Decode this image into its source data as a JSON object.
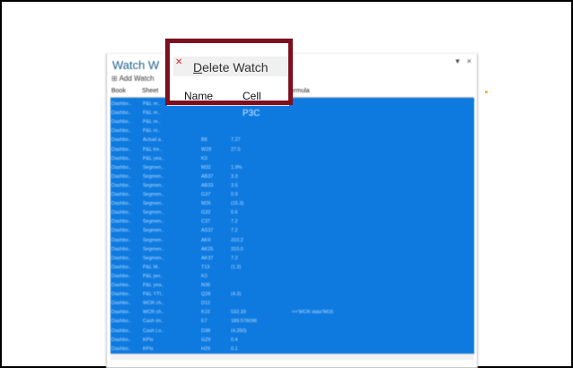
{
  "window": {
    "title": "Watch W",
    "toolbar": {
      "add_label": "Add Watch"
    },
    "controls": {
      "dropdown": "▾",
      "close": "×"
    }
  },
  "columns": [
    "Book",
    "Sheet",
    "Formula"
  ],
  "popup": {
    "menu_item_label_underlined": "D",
    "menu_item_label_rest": "elete Watch",
    "columns": [
      "Name",
      "Cell"
    ]
  },
  "grid": {
    "highlight_cell_text": "P3C",
    "formula_note": "=+'WCR data'!M16",
    "rows": [
      {
        "book": "Dashbo..",
        "sheet": "P&L re..",
        "name": "",
        "cell": "",
        "value": ""
      },
      {
        "book": "Dashbo..",
        "sheet": "P&L re..",
        "name": "",
        "cell": "",
        "value": ""
      },
      {
        "book": "Dashbo..",
        "sheet": "P&L re..",
        "name": "",
        "cell": "",
        "value": ""
      },
      {
        "book": "Dashbo..",
        "sheet": "P&L m..",
        "name": "",
        "cell": "",
        "value": ""
      },
      {
        "book": "Dashbo..",
        "sheet": "Actual a..",
        "name": "",
        "cell": "B8",
        "value": "7.27"
      },
      {
        "book": "Dashbo..",
        "sheet": "P&L tre..",
        "name": "",
        "cell": "W29",
        "value": "27.5"
      },
      {
        "book": "Dashbo..",
        "sheet": "P&L yea..",
        "name": "",
        "cell": "K3",
        "value": ""
      },
      {
        "book": "Dashbo..",
        "sheet": "Segmen..",
        "name": "",
        "cell": "M32",
        "value": "1.9%"
      },
      {
        "book": "Dashbo..",
        "sheet": "Segmen..",
        "name": "",
        "cell": "AB37",
        "value": "3.3"
      },
      {
        "book": "Dashbo..",
        "sheet": "Segmen..",
        "name": "",
        "cell": "AB33",
        "value": "3.5"
      },
      {
        "book": "Dashbo..",
        "sheet": "Segmen..",
        "name": "",
        "cell": "G37",
        "value": "0.9"
      },
      {
        "book": "Dashbo..",
        "sheet": "Segmen..",
        "name": "",
        "cell": "M26",
        "value": "(15.3)"
      },
      {
        "book": "Dashbo..",
        "sheet": "Segmen..",
        "name": "",
        "cell": "G32",
        "value": "0.6"
      },
      {
        "book": "Dashbo..",
        "sheet": "Segmen..",
        "name": "",
        "cell": "C37",
        "value": "7.2"
      },
      {
        "book": "Dashbo..",
        "sheet": "Segmen..",
        "name": "",
        "cell": "AS37",
        "value": "7.2"
      },
      {
        "book": "Dashbo..",
        "sheet": "Segmen..",
        "name": "",
        "cell": "AK9",
        "value": "310.2"
      },
      {
        "book": "Dashbo..",
        "sheet": "Segmen..",
        "name": "",
        "cell": "AK25",
        "value": "310.0"
      },
      {
        "book": "Dashbo..",
        "sheet": "Segmen..",
        "name": "",
        "cell": "AK37",
        "value": "7.2"
      },
      {
        "book": "Dashbo..",
        "sheet": "P&L M..",
        "name": "",
        "cell": "T13",
        "value": "(1.3)"
      },
      {
        "book": "Dashbo..",
        "sheet": "P&L per..",
        "name": "",
        "cell": "K3",
        "value": ""
      },
      {
        "book": "Dashbo..",
        "sheet": "P&L yea..",
        "name": "",
        "cell": "N36",
        "value": ""
      },
      {
        "book": "Dashbo..",
        "sheet": "P&L YTI..",
        "name": "",
        "cell": "Q28",
        "value": "(4.3)"
      },
      {
        "book": "Dashbo..",
        "sheet": "WCR ch..",
        "name": "",
        "cell": "D12",
        "value": ""
      },
      {
        "book": "Dashbo..",
        "sheet": "WCR ch..",
        "name": "",
        "cell": "K15",
        "value": "532.33"
      },
      {
        "book": "Dashbo..",
        "sheet": "Cash im..",
        "name": "",
        "cell": "E7",
        "value": "189.576096"
      },
      {
        "book": "Dashbo..",
        "sheet": "Cash Lo..",
        "name": "",
        "cell": "D38",
        "value": "(4,350)"
      },
      {
        "book": "Dashbo..",
        "sheet": "KPIs",
        "name": "",
        "cell": "G29",
        "value": "0.4"
      },
      {
        "book": "Dashbo..",
        "sheet": "KPIs",
        "name": "",
        "cell": "H29",
        "value": "0.1"
      }
    ]
  },
  "colors": {
    "grid_bg": "#0e7ae0",
    "highlight_border": "#7d0f1e",
    "title_text": "#1e5f8c"
  }
}
